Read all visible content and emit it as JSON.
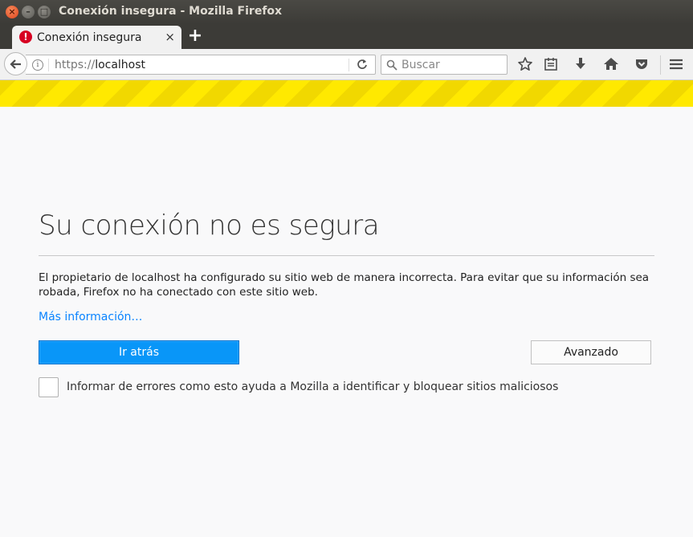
{
  "window": {
    "title": "Conexión insegura - Mozilla Firefox",
    "close_glyph": "×",
    "minimize_glyph": "–",
    "maximize_glyph": "□"
  },
  "tab": {
    "label": "Conexión insegura",
    "icon": "error-icon",
    "icon_glyph": "!",
    "close_glyph": "×",
    "new_tab_glyph": "+"
  },
  "navbar": {
    "url_scheme": "https://",
    "url_host": "localhost",
    "search_placeholder": "Buscar",
    "icons": [
      "back-arrow-icon",
      "info-icon",
      "reload-icon",
      "search-icon",
      "bookmark-star-icon",
      "reading-list-icon",
      "download-icon",
      "home-icon",
      "pocket-icon",
      "hamburger-menu-icon"
    ]
  },
  "colors": {
    "stripe_yellow": "#ffe900",
    "primary_button": "#0996f8",
    "link": "#0a84ff",
    "error_red": "#d70022"
  },
  "content": {
    "title": "Su conexión no es segura",
    "description": "El propietario de localhost ha configurado su sitio web de manera incorrecta. Para evitar que su información sea robada, Firefox no ha conectado con este sitio web.",
    "learn_more": "Más información…",
    "go_back_button": "Ir atrás",
    "advanced_button": "Avanzado",
    "report_checkbox_checked": false,
    "report_label": "Informar de errores como esto ayuda a Mozilla a identificar y bloquear sitios maliciosos"
  }
}
